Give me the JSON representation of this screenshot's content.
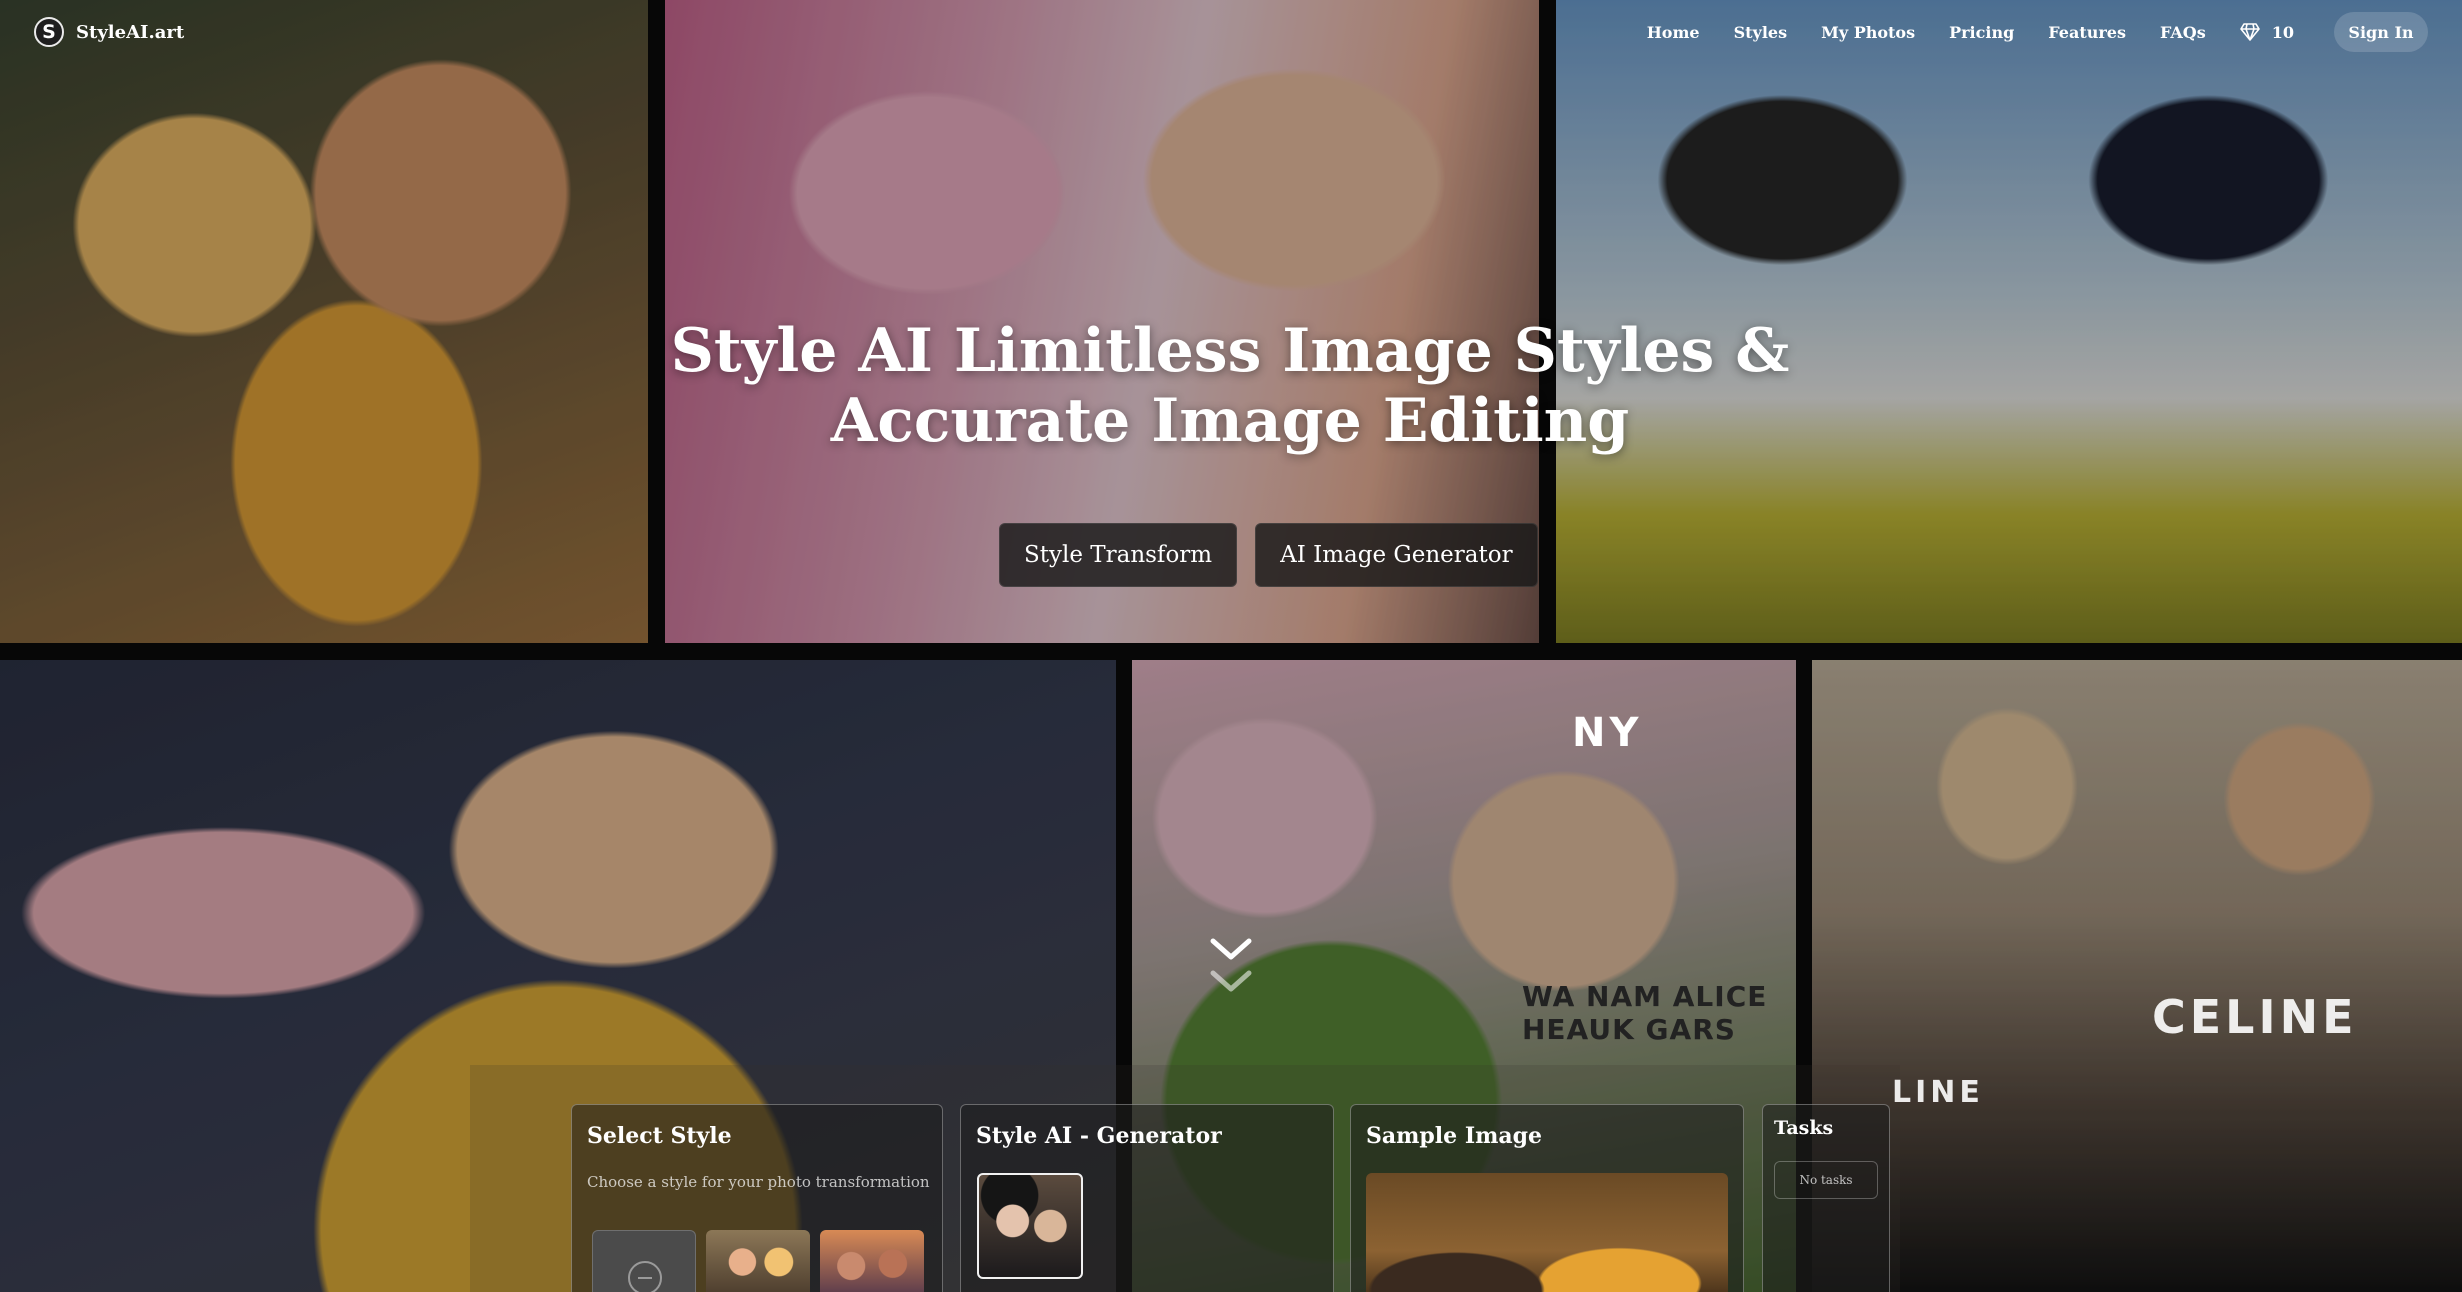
{
  "brand": {
    "logo_letter": "S",
    "name": "StyleAI.art"
  },
  "nav": {
    "links": [
      "Home",
      "Styles",
      "My Photos",
      "Pricing",
      "Features",
      "FAQs"
    ],
    "credits": "10",
    "sign_in": "Sign In"
  },
  "hero": {
    "title_line1": "Style AI Limitless Image Styles &",
    "title_line2": "Accurate Image Editing",
    "buttons": [
      "Style Transform",
      "AI Image Generator"
    ]
  },
  "gallery_text": {
    "cap_ny": "NY",
    "cap_wa": "WA NAM ALICE HEAUK GARS",
    "cap_celine_hoodie": "CELINE",
    "cap_celine_product": "LINE"
  },
  "panels": {
    "select_style": {
      "title": "Select Style",
      "subtitle": "Choose a style for your photo transformation"
    },
    "generator": {
      "title": "Style AI - Generator"
    },
    "sample": {
      "title": "Sample Image"
    },
    "tasks": {
      "title": "Tasks",
      "empty": "No tasks"
    }
  },
  "icons": {
    "brand": "logo-s-icon",
    "credits": "gem-icon",
    "scroll": "chevron-down-icon",
    "empty_style": "minus-circle-icon"
  },
  "colors": {
    "accent": "#ffffff",
    "panel_bg": "#1c1c1c",
    "button_bg": "#181818"
  }
}
